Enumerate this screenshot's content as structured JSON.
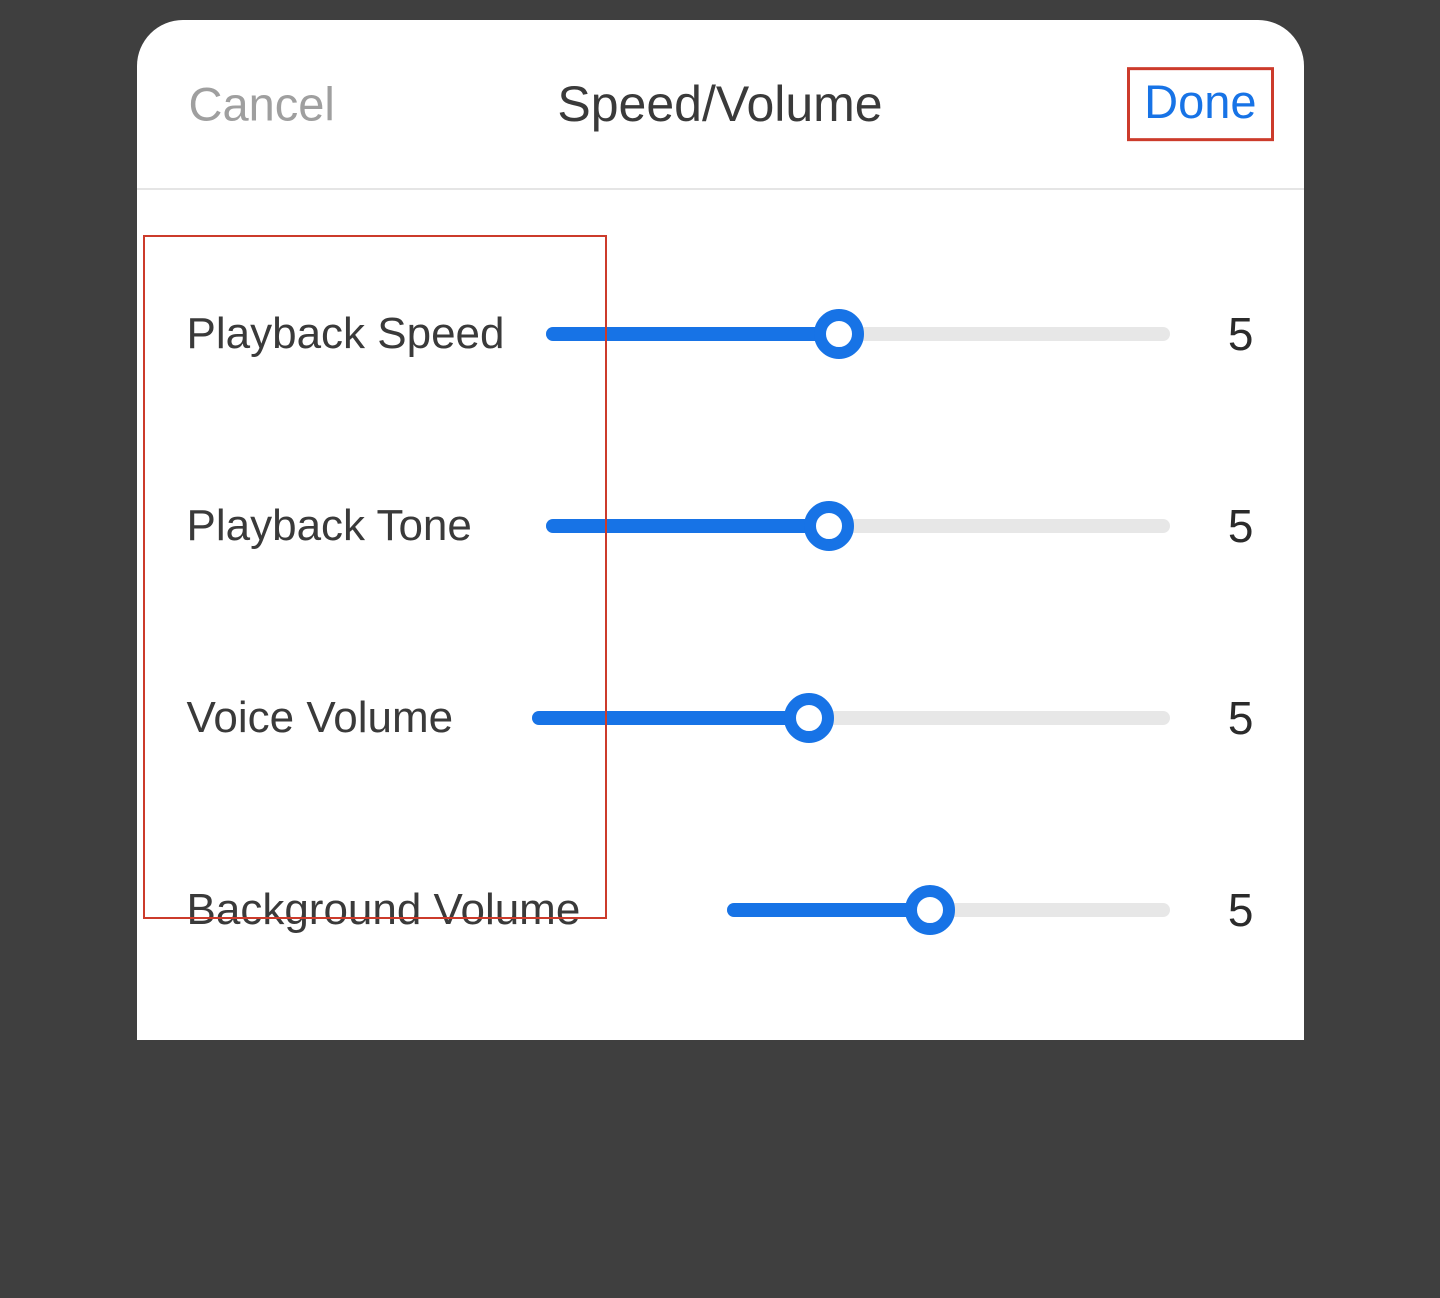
{
  "header": {
    "cancel_label": "Cancel",
    "title": "Speed/Volume",
    "done_label": "Done"
  },
  "sliders": [
    {
      "label": "Playback Speed",
      "value": 5,
      "min": 0,
      "max": 10,
      "fill_pct": 46,
      "thumb_pct": 47
    },
    {
      "label": "Playback Tone",
      "value": 5,
      "min": 0,
      "max": 10,
      "fill_pct": 44.5,
      "thumb_pct": 45.5
    },
    {
      "label": "Voice Volume",
      "value": 5,
      "min": 0,
      "max": 10,
      "fill_pct": 42.5,
      "thumb_pct": 43.5
    },
    {
      "label": "Background Volume",
      "value": 5,
      "min": 0,
      "max": 10,
      "fill_pct": 45,
      "thumb_pct": 46
    }
  ],
  "colors": {
    "accent": "#1773e6",
    "highlight_box": "#cc3b2b"
  }
}
